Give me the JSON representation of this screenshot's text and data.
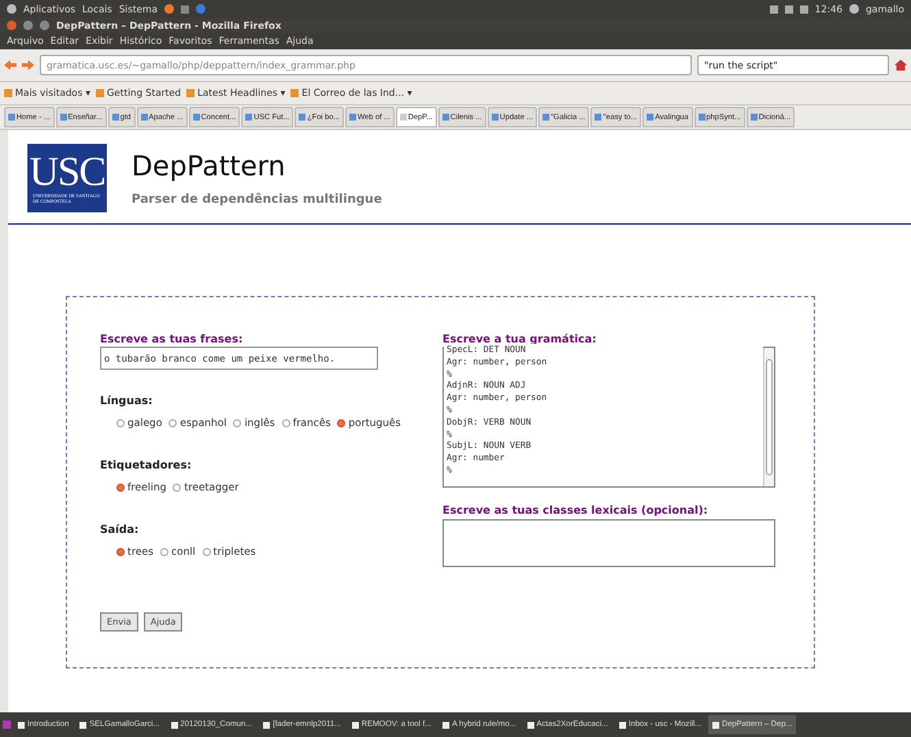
{
  "top_panel": {
    "menus": [
      "Aplicativos",
      "Locais",
      "Sistema"
    ],
    "time": "12:46",
    "user": "gamallo"
  },
  "window": {
    "title": "DepPattern – DepPattern - Mozilla Firefox"
  },
  "menu_bar": [
    "Arquivo",
    "Editar",
    "Exibir",
    "Histórico",
    "Favoritos",
    "Ferramentas",
    "Ajuda"
  ],
  "navigation": {
    "url": "gramatica.usc.es/~gamallo/php/deppattern/index_grammar.php",
    "search": "\"run the script\""
  },
  "bookmarks": [
    "Mais visitados ▾",
    "Getting Started",
    "Latest Headlines ▾",
    "El Correo de las Ind... ▾"
  ],
  "tabs": [
    {
      "label": "Home - ...",
      "selected": false
    },
    {
      "label": "Enseñar...",
      "selected": false
    },
    {
      "label": "gtd",
      "selected": false
    },
    {
      "label": "Apache ...",
      "selected": false
    },
    {
      "label": "Concent...",
      "selected": false
    },
    {
      "label": "USC Fut...",
      "selected": false
    },
    {
      "label": "¿Foi bo...",
      "selected": false
    },
    {
      "label": "Web of ...",
      "selected": false
    },
    {
      "label": "DepP...",
      "selected": true
    },
    {
      "label": "Cilenis ...",
      "selected": false
    },
    {
      "label": "Update ...",
      "selected": false
    },
    {
      "label": "\"Galicia ...",
      "selected": false
    },
    {
      "label": "\"easy to...",
      "selected": false
    },
    {
      "label": "Avalingua",
      "selected": false
    },
    {
      "label": "phpSynt...",
      "selected": false
    },
    {
      "label": "Dicioná...",
      "selected": false
    }
  ],
  "page": {
    "logo": {
      "letters": "USC",
      "caption": "UNIVERSIDADE DE SANTIAGO DE COMPOSTELA"
    },
    "title": "DepPattern",
    "subtitle": "Parser de dependências multilingue",
    "form": {
      "sentences": {
        "label": "Escreve as tuas frases:",
        "value": "o tubarão branco come um peixe vermelho."
      },
      "groups": [
        {
          "label": "Línguas:",
          "options": [
            {
              "label": "galego",
              "selected": false
            },
            {
              "label": "espanhol",
              "selected": false
            },
            {
              "label": "inglês",
              "selected": false
            },
            {
              "label": "francês",
              "selected": false
            },
            {
              "label": "português",
              "selected": true
            }
          ]
        },
        {
          "label": "Etiquetadores:",
          "options": [
            {
              "label": "freeling",
              "selected": true
            },
            {
              "label": "treetagger",
              "selected": false
            }
          ]
        },
        {
          "label": "Saída:",
          "options": [
            {
              "label": "trees",
              "selected": true
            },
            {
              "label": "conll",
              "selected": false
            },
            {
              "label": "tripletes",
              "selected": false
            }
          ]
        }
      ],
      "buttons": [
        "Envia",
        "Ajuda"
      ],
      "grammar": {
        "label": "Escreve a tua gramática:",
        "lines": [
          "SpecL: DET NOUN",
          "Agr: number, person",
          "%",
          "AdjnR: NOUN ADJ",
          "Agr: number, person",
          "%",
          "DobjR: VERB NOUN",
          "%",
          "SubjL: NOUN VERB",
          "Agr: number",
          "%"
        ]
      },
      "lexical": {
        "label": "Escreve as tuas classes lexicais (opcional):"
      }
    }
  },
  "taskbar": [
    "Introduction",
    "SELGamalloGarci...",
    "20120130_Comun...",
    "[fader-emnlp2011...",
    "REMOOV: a tool f...",
    "A hybrid rule/mo...",
    "Actas2XorEducaci...",
    "Inbox - usc - Mozill...",
    "DepPattern – Dep..."
  ]
}
